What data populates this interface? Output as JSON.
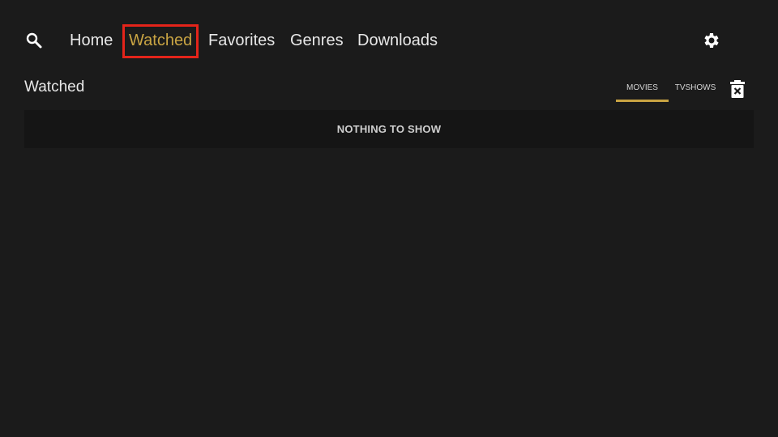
{
  "nav": {
    "search_icon": "search-icon",
    "items": [
      {
        "label": "Home",
        "active": false
      },
      {
        "label": "Watched",
        "active": true
      },
      {
        "label": "Favorites",
        "active": false
      },
      {
        "label": "Genres",
        "active": false
      },
      {
        "label": "Downloads",
        "active": false
      }
    ],
    "settings_icon": "gear-icon"
  },
  "section": {
    "title": "Watched",
    "tabs": [
      {
        "label": "MOVIES",
        "selected": true
      },
      {
        "label": "TVSHOWS",
        "selected": false
      }
    ],
    "clear_icon": "trash-icon",
    "empty_message": "NOTHING TO SHOW"
  },
  "colors": {
    "background": "#1b1b1b",
    "accent": "#c9a443",
    "focus_border": "#e4241a",
    "panel": "#151515"
  }
}
